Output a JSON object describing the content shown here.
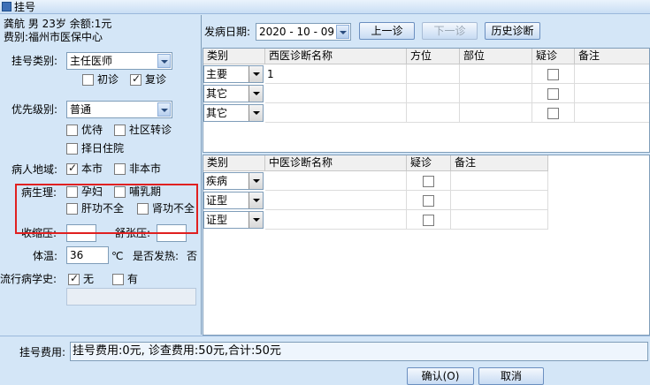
{
  "window": {
    "title": "挂号"
  },
  "patient": {
    "line1": "龚航  男  23岁  余额:1元",
    "line2": "费别:福州市医保中心"
  },
  "left": {
    "reg_type_label": "挂号类别:",
    "reg_type_value": "主任医师",
    "first_visit_label": "初诊",
    "return_visit_label": "复诊",
    "priority_label": "优先级别:",
    "priority_value": "普通",
    "preferential_label": "优待",
    "community_referral_label": "社区转诊",
    "select_day_label": "择日住院",
    "region_label": "病人地域:",
    "local_label": "本市",
    "nonlocal_label": "非本市",
    "physiology_label": "病生理:",
    "pregnant_label": "孕妇",
    "lactation_label": "哺乳期",
    "liver_label": "肝功不全",
    "kidney_label": "肾功不全",
    "systolic_label": "收缩压:",
    "diastolic_label": "舒张压:",
    "temp_label": "体温:",
    "temp_value": "36",
    "temp_unit": "℃",
    "fever_label": "是否发热:",
    "fever_value": "否",
    "epi_label": "流行病学史:",
    "epi_none_label": "无",
    "epi_yes_label": "有"
  },
  "right": {
    "onset_label": "发病日期:",
    "onset_value": "2020 - 10 - 09",
    "prev_button": "上一诊",
    "next_button": "下一诊",
    "history_button": "历史诊断",
    "western_grid": {
      "headers": [
        "类别",
        "西医诊断名称",
        "方位",
        "部位",
        "疑诊",
        "备注"
      ],
      "rows": [
        {
          "category": "主要",
          "name": "1"
        },
        {
          "category": "其它",
          "name": ""
        },
        {
          "category": "其它",
          "name": ""
        }
      ]
    },
    "tcm_grid": {
      "headers": [
        "类别",
        "中医诊断名称",
        "疑诊",
        "备注"
      ],
      "rows": [
        {
          "category": "疾病"
        },
        {
          "category": "证型"
        },
        {
          "category": "证型"
        }
      ]
    }
  },
  "bottom": {
    "fee_label": "挂号费用:",
    "fee_value": "挂号费用:0元, 诊查费用:50元,合计:50元",
    "confirm_button": "确认(O)",
    "cancel_button": "取消"
  }
}
